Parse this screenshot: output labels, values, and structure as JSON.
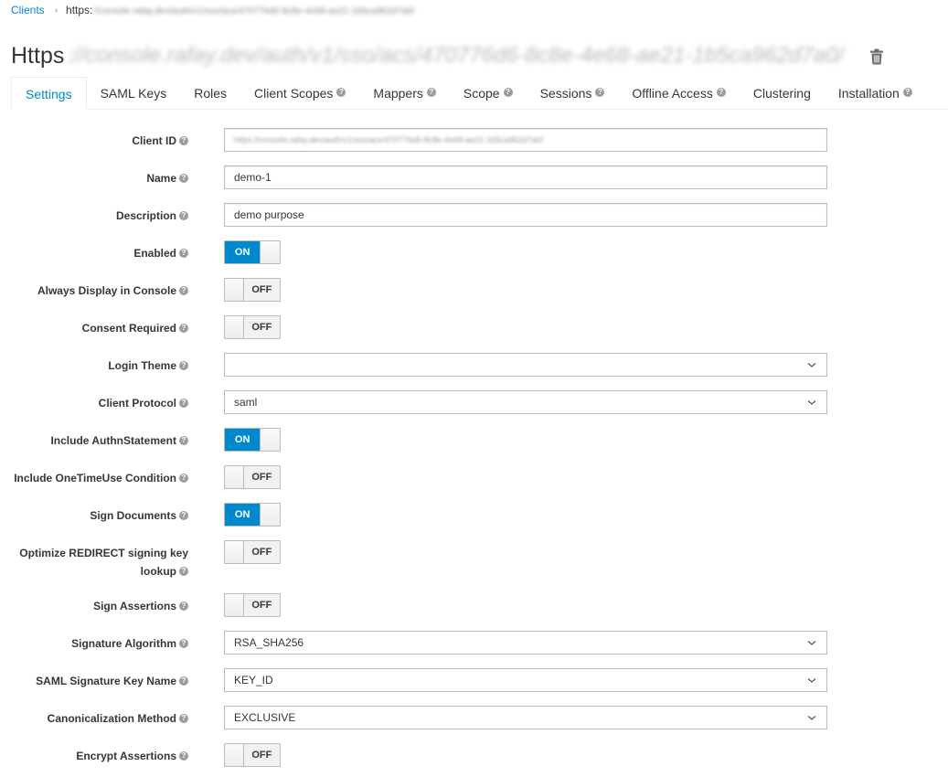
{
  "breadcrumb": {
    "parent": "Clients",
    "separator": "›",
    "current_prefix": "https:",
    "current_obscured": "//console.rafay.dev/auth/v1/sso/acs/470776d6-8c8e-4e68-ae21-1b5ca962d7a0/"
  },
  "header": {
    "title_prefix": "Https",
    "title_obscured": "://console.rafay.dev/auth/v1/sso/acs/470776d6-8c8e-4e68-ae21-1b5ca962d7a0/",
    "delete_icon": "trash-icon"
  },
  "tabs": [
    {
      "label": "Settings",
      "active": true,
      "help": false
    },
    {
      "label": "SAML Keys",
      "active": false,
      "help": false
    },
    {
      "label": "Roles",
      "active": false,
      "help": false
    },
    {
      "label": "Client Scopes",
      "active": false,
      "help": true
    },
    {
      "label": "Mappers",
      "active": false,
      "help": true
    },
    {
      "label": "Scope",
      "active": false,
      "help": true
    },
    {
      "label": "Sessions",
      "active": false,
      "help": true
    },
    {
      "label": "Offline Access",
      "active": false,
      "help": true
    },
    {
      "label": "Clustering",
      "active": false,
      "help": false
    },
    {
      "label": "Installation",
      "active": false,
      "help": true
    }
  ],
  "help_glyph": "?",
  "form": {
    "client_id": {
      "label": "Client ID",
      "value_obscured": "https://console.rafay.dev/auth/v1/sso/acs/470776d6-8c8e-4e68-ae21-1b5ca962d7a0/"
    },
    "name": {
      "label": "Name",
      "value": "demo-1"
    },
    "description": {
      "label": "Description",
      "value": "demo purpose"
    },
    "enabled": {
      "label": "Enabled",
      "state": "ON"
    },
    "always_display": {
      "label": "Always Display in Console",
      "state": "OFF"
    },
    "consent_required": {
      "label": "Consent Required",
      "state": "OFF"
    },
    "login_theme": {
      "label": "Login Theme",
      "value": ""
    },
    "client_protocol": {
      "label": "Client Protocol",
      "value": "saml"
    },
    "include_authn": {
      "label": "Include AuthnStatement",
      "state": "ON"
    },
    "include_onetimeuse": {
      "label": "Include OneTimeUse Condition",
      "state": "OFF"
    },
    "sign_documents": {
      "label": "Sign Documents",
      "state": "ON"
    },
    "optimize_redirect": {
      "label_line1": "Optimize REDIRECT signing key",
      "label_line2": "lookup",
      "state": "OFF"
    },
    "sign_assertions": {
      "label": "Sign Assertions",
      "state": "OFF"
    },
    "signature_algorithm": {
      "label": "Signature Algorithm",
      "value": "RSA_SHA256"
    },
    "saml_key_name": {
      "label": "SAML Signature Key Name",
      "value": "KEY_ID"
    },
    "canonicalization": {
      "label": "Canonicalization Method",
      "value": "EXCLUSIVE"
    },
    "encrypt_assertions": {
      "label": "Encrypt Assertions",
      "state": "OFF"
    }
  },
  "colors": {
    "accent": "#0088ce",
    "text": "#363636",
    "border": "#bbbbbb",
    "help_icon": "#9c9c9c"
  }
}
